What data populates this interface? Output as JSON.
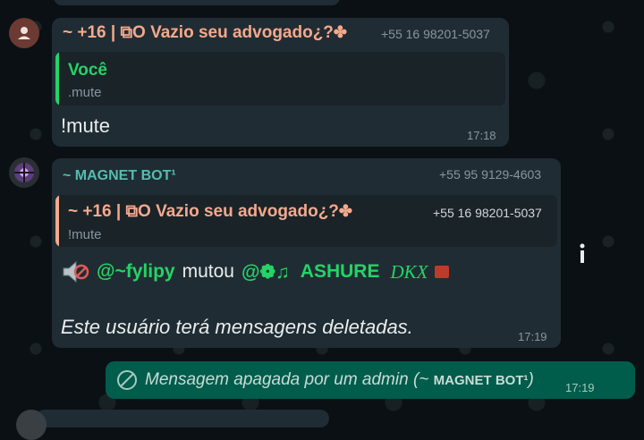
{
  "messages": [
    {
      "sender": "~ +16 | ⧉O Vazio seu advogado¿?✤",
      "phone": "+55 16 98201-5037",
      "quote": {
        "author": "Você",
        "text": ".mute"
      },
      "text": "!mute",
      "time": "17:18"
    },
    {
      "sender": "~ MAGNET BOT¹",
      "phone": "+55 95 9129-4603",
      "quote": {
        "author": "~ +16 | ⧉O Vazio seu advogado¿?✤",
        "phone": "+55 16 98201-5037",
        "text": "!mute"
      },
      "line1": {
        "prefix_icon": "muted-speaker-icon",
        "mention1": "@~fylipy",
        "verb": "mutou",
        "mention2": "@❁♫",
        "mention2_name": "ASHURE",
        "mention2_tag": "DKX"
      },
      "text": "Este usuário terá mensagens deletadas.",
      "time": "17:19"
    },
    {
      "deleted_text": "Mensagem apagada por um admin (~ ",
      "deleted_by": "MAGNET BOT¹",
      "deleted_suffix": ")",
      "time": "17:19"
    }
  ],
  "colors": {
    "sender1": "#f5a98c",
    "sender2": "#53bdb0",
    "quote_you_bar": "#25d366",
    "quote_you_author": "#25d366",
    "quote2_bar": "#f5a98c",
    "mention": "#25d366",
    "outgoing_bg": "#005c4b"
  },
  "info_icon": "info-icon"
}
